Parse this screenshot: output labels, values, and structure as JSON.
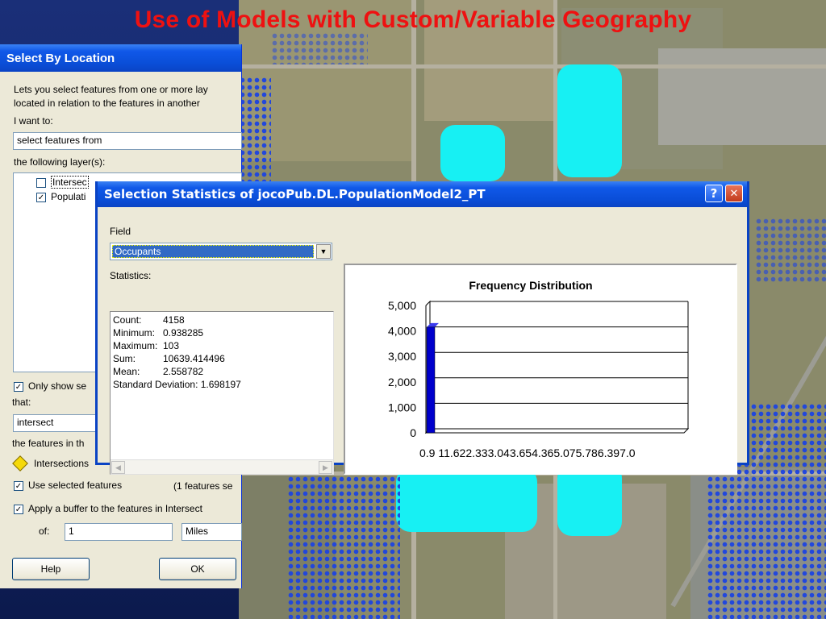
{
  "slide": {
    "title": "Use of Models with Custom/Variable Geography"
  },
  "select_by_location": {
    "title": "Select By Location",
    "description_line1": "Lets you select features from one or more lay",
    "description_line2": "located in relation to the features in another",
    "i_want_to_label": "I want to:",
    "method_value": "select features from",
    "layers_label": "the following layer(s):",
    "layers": [
      {
        "label": "Intersec",
        "checked": false
      },
      {
        "label": "Populati",
        "checked": true
      }
    ],
    "only_show_label": "Only show se",
    "that_label": "that:",
    "relation_value": "intersect",
    "features_in_label": "the features in th",
    "source_layer": "Intersections",
    "use_selected_label": "Use selected features",
    "selected_count": "(1 features se",
    "apply_buffer_label": "Apply a buffer to the features in Intersect",
    "of_label": "of:",
    "buffer_value": "1",
    "buffer_units": "Miles",
    "help_button": "Help",
    "ok_button": "OK"
  },
  "selection_statistics": {
    "title": "Selection Statistics of jocoPub.DL.PopulationModel2_PT",
    "help_glyph": "?",
    "close_glyph": "✕",
    "field_label": "Field",
    "field_value": "Occupants",
    "statistics_label": "Statistics:",
    "stats": [
      {
        "label": "Count:",
        "value": "4158"
      },
      {
        "label": "Minimum:",
        "value": "0.938285"
      },
      {
        "label": "Maximum:",
        "value": "103"
      },
      {
        "label": "Sum:",
        "value": "10639.414496"
      },
      {
        "label": "Mean:",
        "value": "2.558782"
      },
      {
        "label": "Standard Deviation:",
        "value": "1.698197"
      }
    ]
  },
  "chart_data": {
    "type": "bar",
    "title": "Frequency Distribution",
    "xlabel": "",
    "ylabel": "",
    "x_tick_text": "0.9 11.622.333.043.654.365.075.786.397.0",
    "categories": [
      "0.9",
      "11.6",
      "22.3",
      "33.0",
      "43.6",
      "54.3",
      "65.0",
      "75.7",
      "86.3",
      "97.0"
    ],
    "values": [
      4150,
      0,
      0,
      0,
      0,
      0,
      0,
      0,
      0,
      0
    ],
    "yticks": [
      "0",
      "1,000",
      "2,000",
      "3,000",
      "4,000",
      "5,000"
    ],
    "ylim": [
      0,
      5000
    ],
    "grid": true,
    "bar_color": "#0000cc"
  },
  "colors": {
    "titlebar": "#0a4ed8",
    "slide_title": "#ee1111",
    "selection": "#316ac5"
  }
}
